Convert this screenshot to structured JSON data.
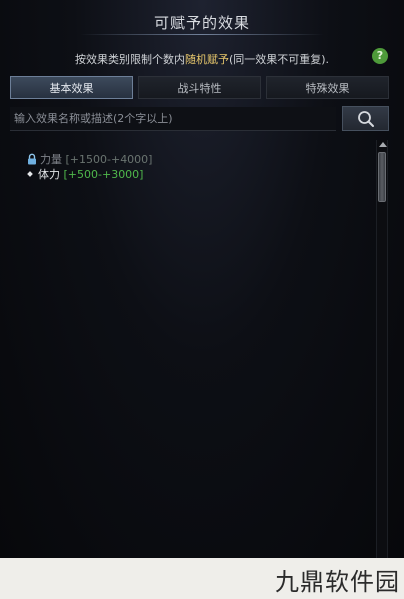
{
  "panel": {
    "title": "可赋予的效果",
    "instruction_prefix": "按效果类别限制个数内",
    "instruction_highlight": "随机赋予",
    "instruction_suffix": "(同一效果不可重复).",
    "help_label": "?",
    "colors": {
      "highlight": "#e7c76c",
      "range_green": "#4fb84b",
      "help_green": "#4e9a3a"
    }
  },
  "tabs": [
    {
      "label": "基本效果",
      "active": true
    },
    {
      "label": "战斗特性",
      "active": false
    },
    {
      "label": "特殊效果",
      "active": false
    }
  ],
  "search": {
    "placeholder": "输入效果名称或描述(2个字以上)",
    "value": "",
    "button_icon": "search-icon"
  },
  "effects": [
    {
      "name": "力量",
      "range": "[+1500-+4000]",
      "locked": true,
      "icon": "lock-icon"
    },
    {
      "name": "体力",
      "range": "[+500-+3000]",
      "locked": false,
      "icon": "bullet-icon"
    }
  ],
  "watermark": "九鼎软件园"
}
